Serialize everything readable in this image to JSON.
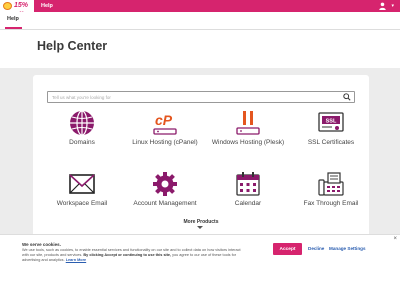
{
  "topbar": {
    "logo_text": "15% off",
    "help_label": "Help",
    "user_caret": "▾",
    "brand_color": "#d6246e"
  },
  "subnav": {
    "tab_label": "Help"
  },
  "header": {
    "title": "Help Center"
  },
  "search": {
    "placeholder": "Tell us what you're looking for"
  },
  "products": [
    {
      "label": "Domains",
      "icon": "globe-icon"
    },
    {
      "label": "Linux Hosting (cPanel)",
      "icon": "cpanel-icon"
    },
    {
      "label": "Windows Hosting (Plesk)",
      "icon": "plesk-icon"
    },
    {
      "label": "SSL Certificates",
      "icon": "ssl-certificate-icon"
    },
    {
      "label": "Workspace Email",
      "icon": "envelope-icon"
    },
    {
      "label": "Account Management",
      "icon": "gear-icon"
    },
    {
      "label": "Calendar",
      "icon": "calendar-icon"
    },
    {
      "label": "Fax Through Email",
      "icon": "fax-icon"
    }
  ],
  "more_products": {
    "label": "More Products"
  },
  "cookie": {
    "title": "We serve cookies.",
    "body_part1": "We use tools, such as cookies, to enable essential services and functionality on our site and to collect data on how visitors interact with our site, products and services. ",
    "body_bold": "By clicking Accept or continuing to use this site,",
    "body_part2": " you agree to our use of these tools for advertising and analytics. ",
    "learn_more": "Learn More",
    "accept_label": "Accept",
    "decline_label": "Decline",
    "manage_label": "Manage Settings",
    "close_glyph": "×"
  }
}
